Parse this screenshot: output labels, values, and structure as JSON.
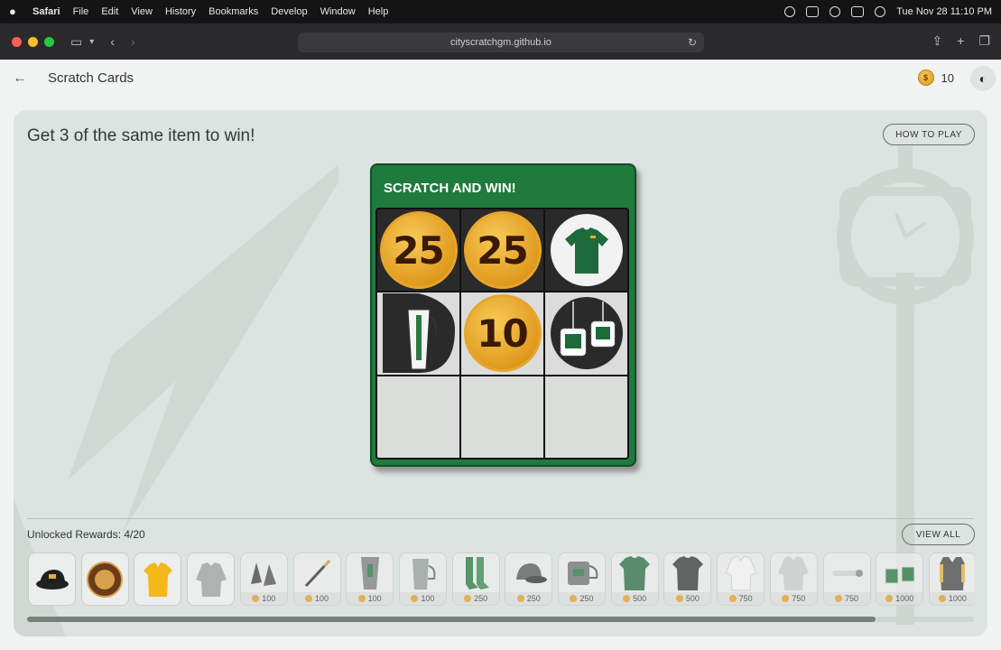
{
  "menubar": {
    "app": "Safari",
    "items": [
      "File",
      "Edit",
      "View",
      "History",
      "Bookmarks",
      "Develop",
      "Window",
      "Help"
    ],
    "datetime": "Tue Nov 28  11:10 PM"
  },
  "browser": {
    "url": "cityscratchgm.github.io"
  },
  "header": {
    "back_icon": "back-arrow-icon",
    "title": "Scratch Cards",
    "coin_balance": "10",
    "theme_icon": "moon-icon"
  },
  "game": {
    "tagline": "Get 3 of the same item to win!",
    "how_to_play": "HOW TO PLAY",
    "card_title": "SCRATCH AND WIN!",
    "cells": [
      {
        "type": "coin",
        "value": "25"
      },
      {
        "type": "coin",
        "value": "25"
      },
      {
        "type": "item",
        "item": "green t-shirt"
      },
      {
        "type": "item",
        "item": "tumbler"
      },
      {
        "type": "coin",
        "value": "10"
      },
      {
        "type": "item",
        "item": "keychain"
      },
      {
        "type": "hidden"
      },
      {
        "type": "hidden"
      },
      {
        "type": "hidden"
      }
    ]
  },
  "rewards": {
    "label": "Unlocked Rewards: 4/20",
    "view_all": "VIEW ALL",
    "items": [
      {
        "name": "hat",
        "price": ""
      },
      {
        "name": "patch",
        "price": ""
      },
      {
        "name": "polo",
        "price": ""
      },
      {
        "name": "pullover",
        "price": ""
      },
      {
        "name": "gloves",
        "price": "100"
      },
      {
        "name": "pen",
        "price": "100"
      },
      {
        "name": "tumbler",
        "price": "100"
      },
      {
        "name": "mug-tall",
        "price": "100"
      },
      {
        "name": "socks",
        "price": "250"
      },
      {
        "name": "cap",
        "price": "250"
      },
      {
        "name": "mug",
        "price": "250"
      },
      {
        "name": "green-shirt",
        "price": "500"
      },
      {
        "name": "black-shirt",
        "price": "500"
      },
      {
        "name": "white-hoodie",
        "price": "750"
      },
      {
        "name": "grey-hoodie",
        "price": "750"
      },
      {
        "name": "lanyard",
        "price": "750"
      },
      {
        "name": "keychains",
        "price": "1000"
      },
      {
        "name": "vest",
        "price": "1000"
      }
    ]
  },
  "colors": {
    "card_green": "#1f7a3d",
    "coin_gold": "#e09b1e"
  }
}
